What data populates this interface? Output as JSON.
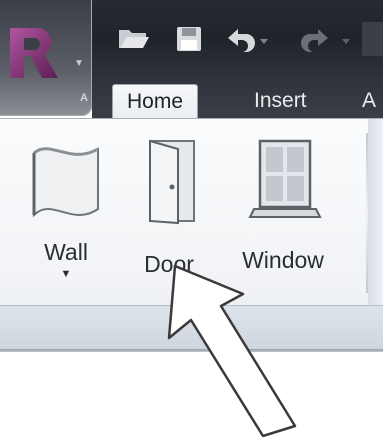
{
  "app": {
    "logo_icon": "revit-r-logo",
    "menu_letter": "A"
  },
  "quick_access": {
    "icons": [
      "open-folder-icon",
      "save-icon",
      "undo-icon",
      "redo-icon"
    ]
  },
  "tabs": [
    {
      "label": "Home",
      "active": true
    },
    {
      "label": "Insert",
      "active": false
    },
    {
      "label": "A",
      "active": false
    }
  ],
  "ribbon": {
    "tools": [
      {
        "label": "Wall",
        "icon": "wall-icon",
        "has_dropdown": true,
        "dropdown_glyph": "▼"
      },
      {
        "label": "Door",
        "icon": "door-icon",
        "has_dropdown": false
      },
      {
        "label": "Window",
        "icon": "window-icon",
        "has_dropdown": false
      }
    ]
  },
  "annotation": {
    "arrow_icon": "pointer-arrow-icon",
    "points_to": "Door"
  },
  "colors": {
    "titlebar": "#262a33",
    "tab_active_bg": "#f7f8fa",
    "ribbon_bg": "#f1f3f6",
    "logo_accent": "#7b2d6e"
  }
}
